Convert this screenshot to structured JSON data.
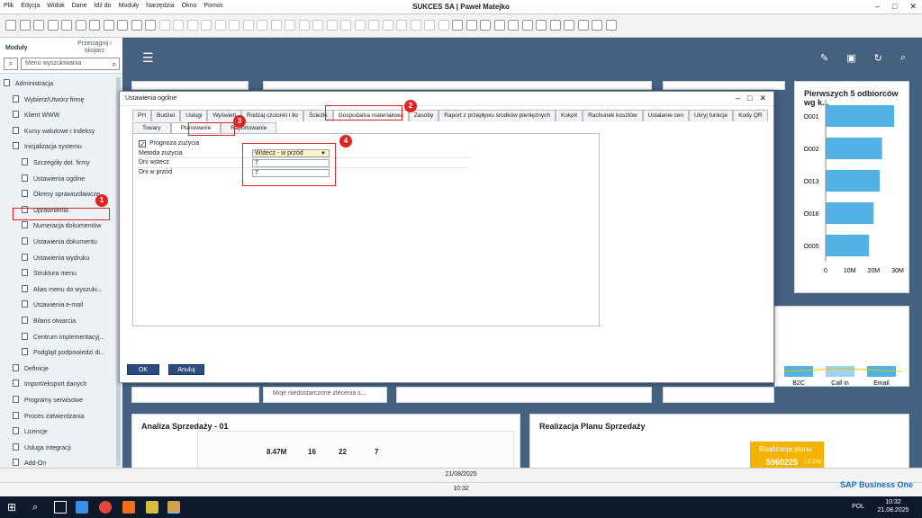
{
  "menu": [
    "Plik",
    "Edycja",
    "Widok",
    "Dane",
    "Idź do",
    "Moduły",
    "Narzędzia",
    "Okno",
    "Pomoc"
  ],
  "app_title": "SUKCES SA | Paweł Matejko",
  "sidebar": {
    "tab_modules": "Moduły",
    "tab_drag": "Przeciągnij i skojarz",
    "search_placeholder": "Menu wyszukiwania",
    "items": [
      {
        "label": "Administracja",
        "level": 0
      },
      {
        "label": "Wybierz/Utwórz firmę",
        "level": 1
      },
      {
        "label": "Klient WWW",
        "level": 1
      },
      {
        "label": "Kursy walutowe i indeksy",
        "level": 1
      },
      {
        "label": "Inicjalizacja systemu",
        "level": 1
      },
      {
        "label": "Szczegóły dot. firmy",
        "level": 2
      },
      {
        "label": "Ustawienia ogólne",
        "level": 2
      },
      {
        "label": "Okresy sprawozdawcze",
        "level": 2
      },
      {
        "label": "Uprawnienia",
        "level": 2
      },
      {
        "label": "Numeracja dokumentów",
        "level": 2
      },
      {
        "label": "Ustawienia dokumentu",
        "level": 2
      },
      {
        "label": "Ustawienia wydruku",
        "level": 2
      },
      {
        "label": "Struktura menu",
        "level": 2
      },
      {
        "label": "Alias menu do wyszuki...",
        "level": 2
      },
      {
        "label": "Ustawienia e-mail",
        "level": 2
      },
      {
        "label": "Bilans otwarcia",
        "level": 2
      },
      {
        "label": "Centrum implementacyj...",
        "level": 2
      },
      {
        "label": "Podgląd podpowiedzi di...",
        "level": 2
      },
      {
        "label": "Definicje",
        "level": 1
      },
      {
        "label": "Import/eksport danych",
        "level": 1
      },
      {
        "label": "Programy serwisowe",
        "level": 1
      },
      {
        "label": "Proces zatwierdzania",
        "level": 1
      },
      {
        "label": "Licencje",
        "level": 1
      },
      {
        "label": "Usługa integracji",
        "level": 1
      },
      {
        "label": "Add-On",
        "level": 1
      }
    ]
  },
  "badges": [
    "1",
    "2",
    "3",
    "4"
  ],
  "dialog": {
    "title": "Ustawienia ogólne",
    "tabs": [
      "PH",
      "Budżet",
      "Usługi",
      "Wyświetl",
      "Rodzaj czcionki i tło",
      "Ścieżki",
      "Gospodarka materiałowa",
      "Zasoby",
      "Raport z przepływu środków pieniężnych",
      "Kokpit",
      "Rachunek kosztów",
      "Ustalanie cen",
      "Ukryj funkcje",
      "Kody QR"
    ],
    "subtabs": [
      "Towary",
      "Planowanie",
      "Raportowanie"
    ],
    "checkbox_label": "Prognoza zużycia",
    "fields": [
      {
        "label": "Metoda zużycia",
        "value": "Wstecz - w przód"
      },
      {
        "label": "Dni wstecz",
        "value": "7"
      },
      {
        "label": "Dni w przód",
        "value": "7"
      }
    ],
    "ok": "OK",
    "cancel": "Anuluj"
  },
  "cards": {
    "top_customers_title": "Pierwszych 5 odbiorców wg k...",
    "shortage_text": "Moje niedostarczone zlecenia s...",
    "sales_title": "Analiza Sprzedaży - 01",
    "plan_title": "Realizacja Planu Sprzedaży",
    "plan_value_label": "Realizacja planu",
    "plan_value": "5960225",
    "plan_pct": "(-2.1%)",
    "kpi_values": [
      "8.47M",
      "16",
      "22",
      "7"
    ],
    "channel_labels": [
      "B2C",
      "Call in",
      "Email"
    ]
  },
  "chart_data": {
    "type": "bar",
    "title": "Pierwszych 5 odbiorców wg k...",
    "categories": [
      "O001",
      "O002",
      "O013",
      "O016",
      "O005"
    ],
    "values": [
      28.5,
      23.5,
      22.5,
      20,
      18
    ],
    "xticks": [
      "0",
      "10M",
      "20M",
      "30M"
    ],
    "xlim": [
      0,
      30
    ]
  },
  "status": {
    "date": "21/08/2025",
    "time": "10:32"
  },
  "taskbar": {
    "lang": "POL",
    "time": "10:32",
    "date": "21.08.2025"
  },
  "sap_logo": "SAP Business One"
}
